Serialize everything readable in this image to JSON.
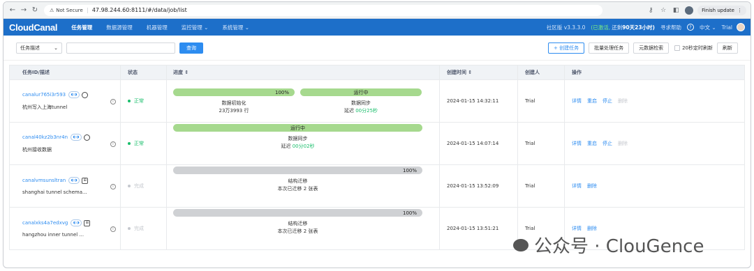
{
  "browser": {
    "security_label": "Not Secure",
    "url": "47.98.244.60:8111/#/data/job/list",
    "finish_update": "Finish update"
  },
  "nav": {
    "logo": "CloudCanal",
    "items": [
      "任务管理",
      "数据源管理",
      "机器管理",
      "监控管理 ⌄",
      "系统管理 ⌄"
    ],
    "edition": "社区版 v3.3.3.0",
    "trial_status": "(已激活,",
    "remaining_prefix": "还剩",
    "remaining_days": "90天23小时)",
    "help": "寻求帮助",
    "language": "中文 ⌄",
    "user": "Trial"
  },
  "toolbar": {
    "select_value": "任务描述",
    "search_placeholder": "",
    "query_label": "查询",
    "create_label": "+ 创建任务",
    "batch_label": "批量处理任务",
    "metadata_label": "元数据检索",
    "auto_refresh_label": "20秒定时刷新",
    "refresh_label": "刷新"
  },
  "table": {
    "headers": [
      "任务ID/描述",
      "状态",
      "进度 ⇕",
      "创建时间 ⇕",
      "创建人",
      "操作"
    ],
    "rows": [
      {
        "id": "canalur765i3r593",
        "desc": "杭州写入上海tunnel",
        "status": "正常",
        "status_kind": "ok",
        "bar1_text": "100%",
        "bar1_progress": 100,
        "label1": "数据初始化",
        "sub1": "23万3993 行",
        "bar2_text": "运行中",
        "label2": "数据同步",
        "sub2_prefix": "延迟 ",
        "sub2_value": "00分25秒",
        "time": "2024-01-15 14:32:11",
        "creator": "Trial",
        "ops": [
          "详情",
          "重启",
          "停止",
          "删除"
        ]
      },
      {
        "id": "canal40kz2b3nr4n",
        "desc": "杭州接收数据",
        "status": "正常",
        "status_kind": "ok",
        "bar_text": "运行中",
        "label": "数据同步",
        "sub_prefix": "延迟 ",
        "sub_value": "00分02秒",
        "time": "2024-01-15 14:07:14",
        "creator": "Trial",
        "ops": [
          "详情",
          "重启",
          "停止",
          "删除"
        ]
      },
      {
        "id": "canalvmsunsltran",
        "desc": "shanghai tunnel schema...",
        "status": "完成",
        "status_kind": "done",
        "bar_text": "100%",
        "bar_progress": 100,
        "label": "结构迁移",
        "sub": "本次已迁移 2 张表",
        "time": "2024-01-15 13:52:09",
        "creator": "Trial",
        "ops": [
          "详情",
          "删除"
        ]
      },
      {
        "id": "canalxks4a7edxvg",
        "desc": "hangzhou inner tunnel ...",
        "status": "完成",
        "status_kind": "done",
        "bar_text": "100%",
        "bar_progress": 100,
        "label": "结构迁移",
        "sub": "本次已迁移 2 张表",
        "time": "2024-01-15 13:51:21",
        "creator": "Trial",
        "ops": [
          "详情",
          "删除"
        ]
      }
    ]
  },
  "watermark": "公众号 · ClouGence"
}
